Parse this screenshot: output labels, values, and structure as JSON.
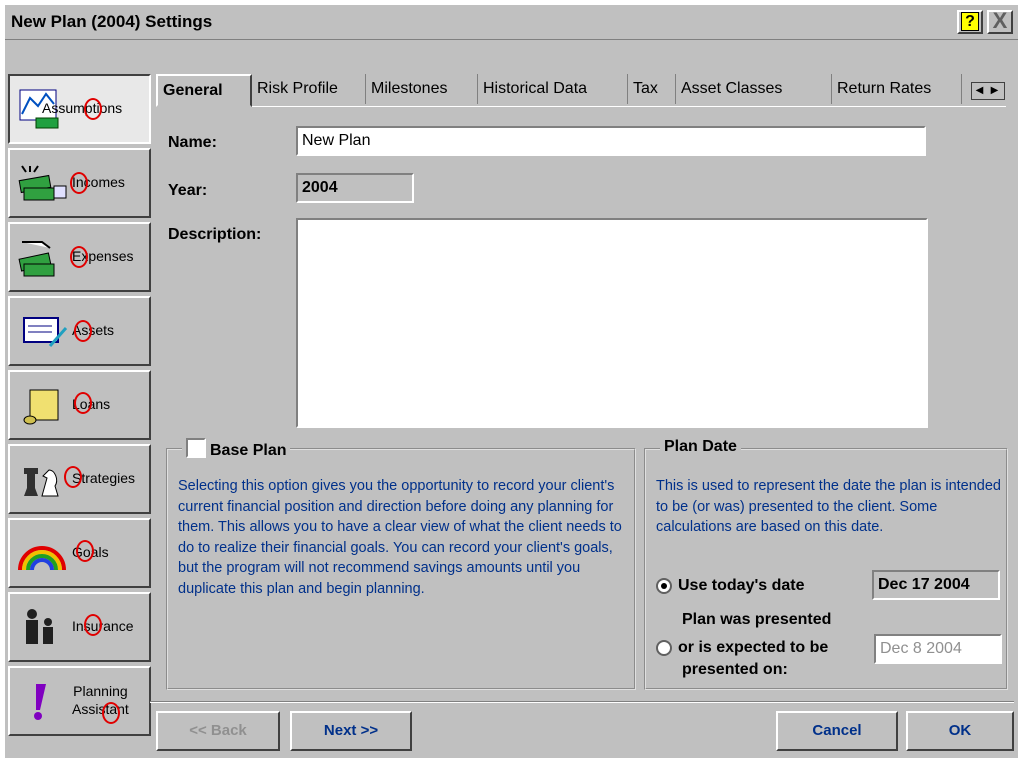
{
  "window": {
    "title": "New Plan (2004) Settings",
    "help_label": "?",
    "close_label": "X"
  },
  "sidebar": {
    "items": [
      {
        "label": "Assumptions",
        "icon": "assumptions-chart-icon"
      },
      {
        "label": "Incomes",
        "icon": "money-hand-icon"
      },
      {
        "label": "Expenses",
        "icon": "money-out-icon"
      },
      {
        "label": "Assets",
        "icon": "document-pen-icon"
      },
      {
        "label": "Loans",
        "icon": "scroll-icon"
      },
      {
        "label": "Strategies",
        "icon": "chess-pieces-icon"
      },
      {
        "label": "Goals",
        "icon": "rainbow-icon"
      },
      {
        "label": "Insurance",
        "icon": "family-icon"
      },
      {
        "label_line1": "Planning",
        "label_line2": "Assistant",
        "icon": "exclamation-icon"
      }
    ]
  },
  "tabs": [
    "General",
    "Risk Profile",
    "Milestones",
    "Historical Data",
    "Tax",
    "Asset Classes",
    "Return Rates"
  ],
  "form": {
    "name_label": "Name:",
    "name_value": "New Plan",
    "year_label": "Year:",
    "year_value": "2004",
    "description_label": "Description:",
    "description_value": ""
  },
  "base_plan": {
    "title": "Base Plan",
    "text": "Selecting this option gives you the opportunity to record your client's current financial position and direction before doing any planning for them. This allows you to have a clear view of what the client needs to do to realize their financial goals. You can record your client's goals, but the program will not recommend savings amounts until you duplicate this plan and begin planning."
  },
  "plan_date": {
    "title": "Plan Date",
    "text": "This is used to represent the date the plan is intended to be (or was) presented to the client.  Some calculations are based on this date.",
    "option_today_label": "Use today's date",
    "today_value": "Dec 17 2004",
    "option_other_line1": "Plan was presented",
    "option_other_line2": "or is expected to be",
    "option_other_line3": "presented on:",
    "other_value": "Dec 8 2004"
  },
  "buttons": {
    "back": "<< Back",
    "next": "Next >>",
    "cancel": "Cancel",
    "ok": "OK"
  },
  "colors": {
    "face": "#c0c0c0",
    "info_text": "#00308a",
    "annotation": "#e00000"
  }
}
